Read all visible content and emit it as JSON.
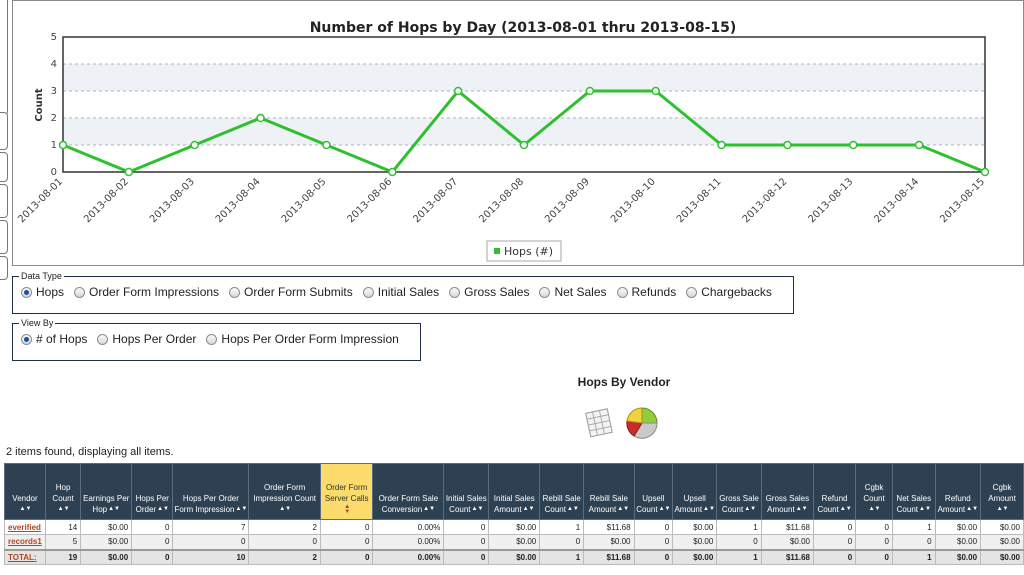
{
  "chart_data": {
    "type": "line",
    "title": "Number of Hops by Day (2013-08-01 thru 2013-08-15)",
    "ylabel": "Count",
    "xlabel": "",
    "ylim": [
      0,
      5
    ],
    "yticks": [
      0,
      1,
      2,
      3,
      4,
      5
    ],
    "grid": true,
    "legend_position": "bottom-center",
    "categories": [
      "2013-08-01",
      "2013-08-02",
      "2013-08-03",
      "2013-08-04",
      "2013-08-05",
      "2013-08-06",
      "2013-08-07",
      "2013-08-08",
      "2013-08-09",
      "2013-08-10",
      "2013-08-11",
      "2013-08-12",
      "2013-08-13",
      "2013-08-14",
      "2013-08-15"
    ],
    "series": [
      {
        "name": "Hops (#)",
        "color": "#2ec02e",
        "values": [
          1,
          0,
          1,
          2,
          1,
          0,
          3,
          1,
          3,
          3,
          1,
          1,
          1,
          1,
          0
        ]
      }
    ]
  },
  "data_type": {
    "legend": "Data Type",
    "options": [
      "Hops",
      "Order Form Impressions",
      "Order Form Submits",
      "Initial Sales",
      "Gross Sales",
      "Net Sales",
      "Refunds",
      "Chargebacks"
    ],
    "selected": 0
  },
  "view_by": {
    "legend": "View By",
    "options": [
      "# of Hops",
      "Hops Per Order",
      "Hops Per Order Form Impression"
    ],
    "selected": 0
  },
  "vendor_section": {
    "title": "Hops By Vendor",
    "icons": [
      "table-view-icon",
      "pie-chart-icon"
    ]
  },
  "items_found": "2 items found, displaying all items.",
  "table": {
    "sorted_column": 6,
    "columns": [
      "Vendor",
      "Hop Count",
      "Earnings Per Hop",
      "Hops Per Order",
      "Hops Per Order Form Impression",
      "Order Form Impression Count",
      "Order Form Server Calls",
      "Order Form Sale Conversion",
      "Initial Sales Count",
      "Initial Sales Amount",
      "Rebill Sale Count",
      "Rebill Sale Amount",
      "Upsell Count",
      "Upsell Amount",
      "Gross Sale Count",
      "Gross Sales Amount",
      "Refund Count",
      "Cgbk Count",
      "Net Sales Count",
      "Refund Amount",
      "Cgbk Amount"
    ],
    "rows": [
      [
        "everified",
        "14",
        "$0.00",
        "0",
        "7",
        "2",
        "0",
        "0.00%",
        "0",
        "$0.00",
        "1",
        "$11.68",
        "0",
        "$0.00",
        "1",
        "$11.68",
        "0",
        "0",
        "1",
        "$0.00",
        "$0.00"
      ],
      [
        "records1",
        "5",
        "$0.00",
        "0",
        "0",
        "0",
        "0",
        "0.00%",
        "0",
        "$0.00",
        "0",
        "$0.00",
        "0",
        "$0.00",
        "0",
        "$0.00",
        "0",
        "0",
        "0",
        "$0.00",
        "$0.00"
      ]
    ],
    "total": [
      "TOTAL:",
      "19",
      "$0.00",
      "0",
      "10",
      "2",
      "0",
      "0.00%",
      "0",
      "$0.00",
      "1",
      "$11.68",
      "0",
      "$0.00",
      "1",
      "$11.68",
      "0",
      "0",
      "1",
      "$0.00",
      "$0.00"
    ]
  },
  "colors": {
    "header_bg": "#2e4152",
    "sorted_header_bg": "#fadb6b",
    "link": "#b3451d",
    "line": "#2ec02e"
  }
}
